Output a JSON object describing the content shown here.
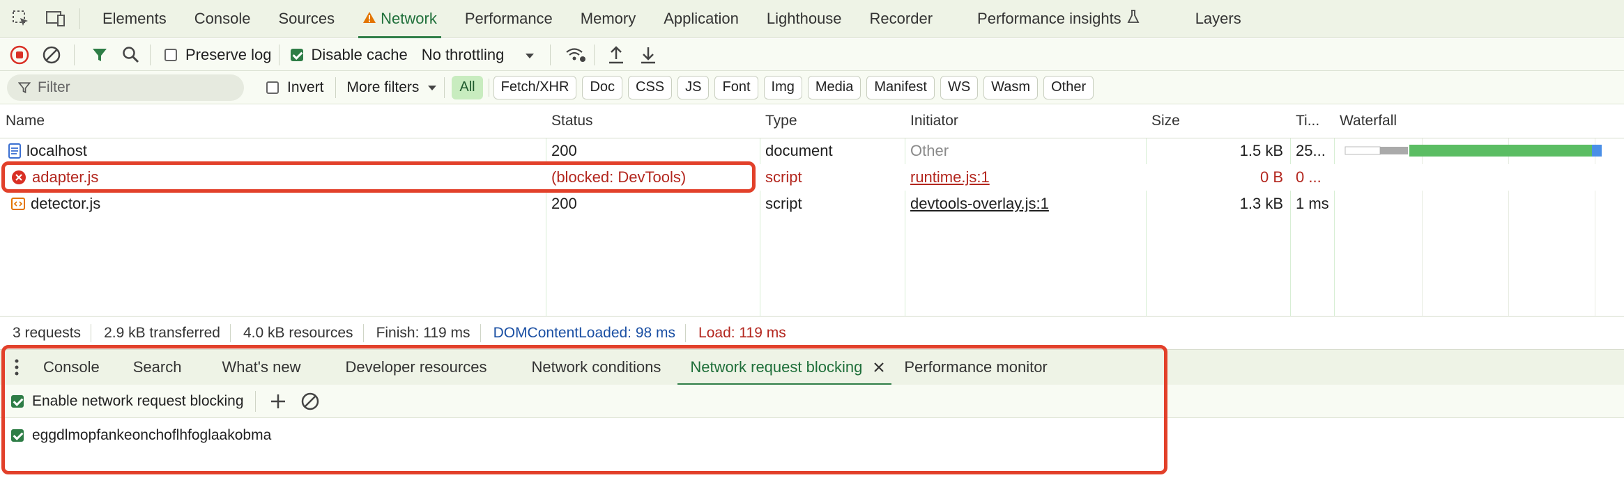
{
  "main_tabs": [
    "Elements",
    "Console",
    "Sources",
    "Network",
    "Performance",
    "Memory",
    "Application",
    "Lighthouse",
    "Recorder",
    "Performance insights",
    "Layers"
  ],
  "active_tab": "Network",
  "toolbar": {
    "preserve_log": "Preserve log",
    "preserve_log_checked": false,
    "disable_cache": "Disable cache",
    "disable_cache_checked": true,
    "throttling": "No throttling"
  },
  "filterbar": {
    "filter_placeholder": "Filter",
    "invert": "Invert",
    "more_filters": "More filters",
    "chips": [
      "All",
      "Fetch/XHR",
      "Doc",
      "CSS",
      "JS",
      "Font",
      "Img",
      "Media",
      "Manifest",
      "WS",
      "Wasm",
      "Other"
    ],
    "active_chip": "All"
  },
  "table": {
    "headers": [
      "Name",
      "Status",
      "Type",
      "Initiator",
      "Size",
      "Ti...",
      "Waterfall"
    ],
    "rows": [
      {
        "name": "localhost",
        "status": "200",
        "type": "document",
        "initiator": "Other",
        "size": "1.5 kB",
        "time": "25...",
        "icon": "document-icon",
        "blocked": false
      },
      {
        "name": "adapter.js",
        "status": "(blocked: DevTools)",
        "type": "script",
        "initiator": "runtime.js:1",
        "size": "0 B",
        "time": "0 ...",
        "icon": "error-icon",
        "blocked": true
      },
      {
        "name": "detector.js",
        "status": "200",
        "type": "script",
        "initiator": "devtools-overlay.js:1",
        "size": "1.3 kB",
        "time": "1 ms",
        "icon": "script-icon",
        "blocked": false
      }
    ]
  },
  "summary": {
    "requests": "3 requests",
    "transferred": "2.9 kB transferred",
    "resources": "4.0 kB resources",
    "finish": "Finish: 119 ms",
    "dcl": "DOMContentLoaded: 98 ms",
    "load": "Load: 119 ms"
  },
  "drawer": {
    "tabs": [
      "Console",
      "Search",
      "What's new",
      "Developer resources",
      "Network conditions",
      "Network request blocking",
      "Performance monitor"
    ],
    "active_tab": "Network request blocking",
    "enable_label": "Enable network request blocking",
    "enable_checked": true,
    "patterns": [
      {
        "text": "eggdlmopfankeonchoflhfoglaakobma",
        "checked": true
      }
    ]
  },
  "colors": {
    "accent": "#2e7d46",
    "error": "#b3261e",
    "highlight": "#e2402a",
    "dcl": "#1a4fa3"
  }
}
